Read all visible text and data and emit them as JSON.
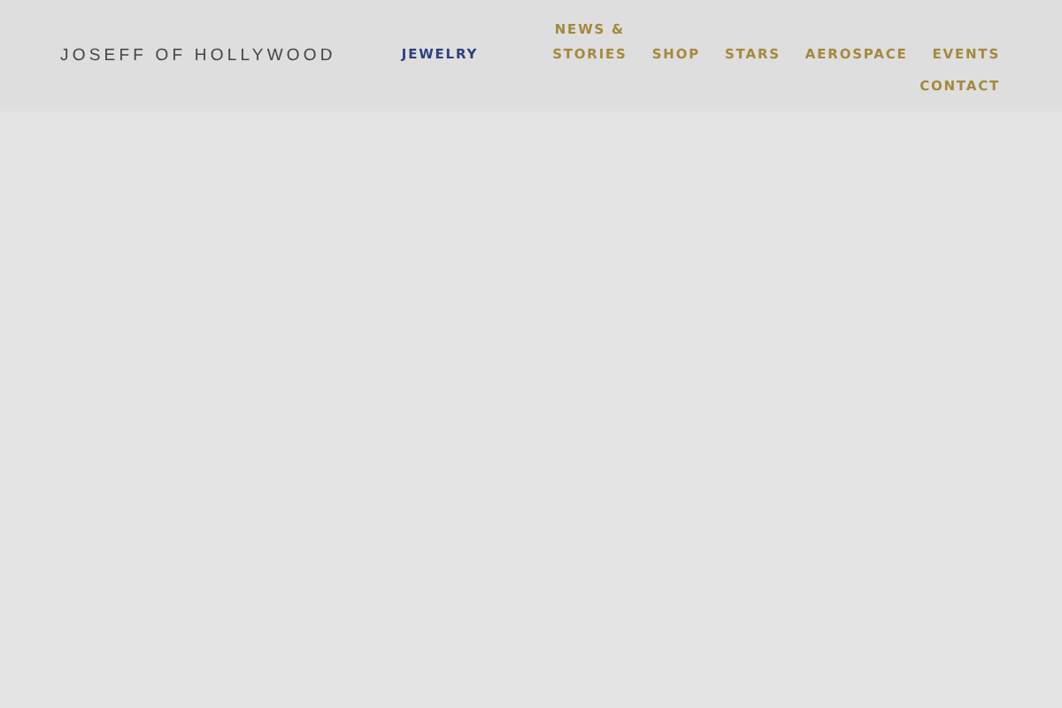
{
  "logo": "JOSEFF OF HOLLYWOOD",
  "nav": [
    {
      "label": "JEWELRY",
      "selected": true
    },
    {
      "label": "NEWS & STORIES",
      "selected": false
    },
    {
      "label": "SHOP",
      "selected": false
    },
    {
      "label": "STARS",
      "selected": false
    },
    {
      "label": "AEROSPACE",
      "selected": false
    },
    {
      "label": "EVENTS",
      "selected": false
    },
    {
      "label": "CONTACT",
      "selected": false
    }
  ]
}
